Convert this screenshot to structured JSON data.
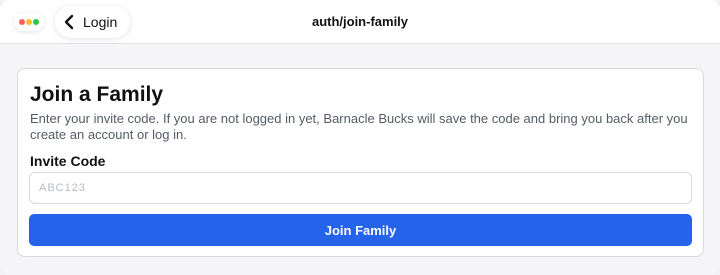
{
  "header": {
    "back_label": "Login",
    "title": "auth/join-family"
  },
  "card": {
    "title": "Join a Family",
    "description": "Enter your invite code. If you are not logged in yet, Barnacle Bucks will save the code and bring you back after you create an account or log in.",
    "invite_label": "Invite Code",
    "invite_value": "",
    "invite_placeholder": "ABC123",
    "submit_label": "Join Family"
  },
  "colors": {
    "primary": "#2563eb",
    "page_background": "#f5f5f7",
    "card_border": "#d9d9de",
    "muted_text": "#555b66"
  },
  "icons": {
    "back": "chevron-left-icon",
    "window_controls": [
      "red-dot-icon",
      "yellow-dot-icon",
      "green-dot-icon"
    ]
  }
}
